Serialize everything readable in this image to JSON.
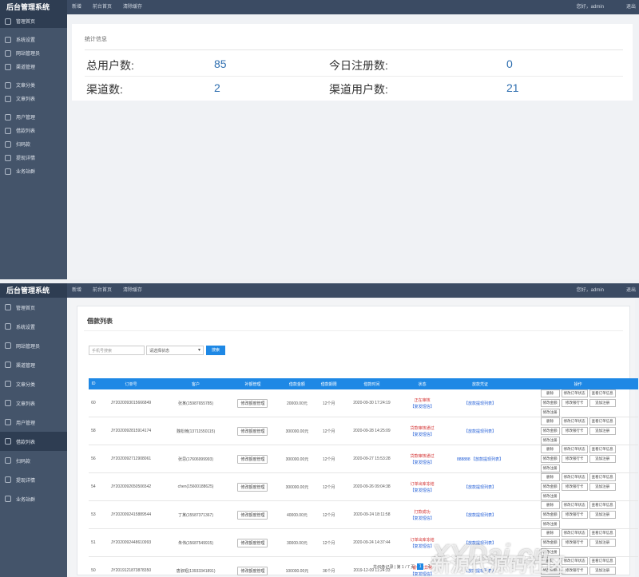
{
  "app_title": "后台管理系统",
  "top_nav": [
    "新增",
    "前台首页",
    "清除缓存"
  ],
  "user_greeting": "您好，admin",
  "logout": "退出",
  "sidebar1": [
    "管理首页",
    "系统设置",
    "网站管理员",
    "渠道管理",
    "文章分类",
    "文章列表",
    "用户管理",
    "借款列表",
    "扫码款",
    "提现详情",
    "业务站群"
  ],
  "stats": {
    "title": "统计信息",
    "total_users_label": "总用户数:",
    "total_users": "85",
    "today_reg_label": "今日注册数:",
    "today_reg": "0",
    "channels_label": "渠道数:",
    "channels": "2",
    "channel_users_label": "渠道用户数:",
    "channel_users": "21"
  },
  "sidebar2": [
    "管理首页",
    "系统设置",
    "网站管理员",
    "渠道管理",
    "文章分类",
    "文章列表",
    "用户管理",
    "借款列表",
    "扫码款",
    "提现详情",
    "业务站群"
  ],
  "loan": {
    "title": "借款列表",
    "search_placeholder": "手机号搜索",
    "select_value": "请选择状态",
    "search_button": "搜索",
    "headers": [
      "ID",
      "订单号",
      "客户",
      "补额管理",
      "借款金额",
      "借款期限",
      "借款时间",
      "状态",
      "放款凭证",
      "操作"
    ],
    "rows": [
      {
        "id": "60",
        "order": "JY2020093015666849",
        "customer": "张某(15987655785)",
        "amount": "20000.00元",
        "term": "12个月",
        "time": "2020-09-30 17:24:19",
        "status1": "正在审核",
        "status2": "【复发短信】",
        "voucher": "【放款提现列表】"
      },
      {
        "id": "58",
        "order": "JY2020092815914174",
        "customer": "魏松楠(13711550115)",
        "amount": "300000.00元",
        "term": "12个月",
        "time": "2020-09-28 14:25:09",
        "status1": "贷款审核通过",
        "status2": "【复发短信】",
        "voucher": "【放款提现列表】"
      },
      {
        "id": "56",
        "order": "JY2020092712908061",
        "customer": "张思(17606999993)",
        "amount": "300000.00元",
        "term": "12个月",
        "time": "2020-09-27 15:53:28",
        "status1": "贷款审核通过",
        "status2": "【复发短信】",
        "voucher": "888888 【放款提现列表】"
      },
      {
        "id": "54",
        "order": "JY2020092650506542",
        "customer": "chen(15600188625)",
        "amount": "300000.00元",
        "term": "12个月",
        "time": "2020-09-26 09:04:38",
        "status1": "订单出库冻结",
        "status2": "【复发短信】",
        "voucher": "【放款提现列表】"
      },
      {
        "id": "53",
        "order": "JY2020092415889544",
        "customer": "丁某(15587371367)",
        "amount": "40000.00元",
        "term": "12个月",
        "time": "2020-09-24 18:11:58",
        "status1": "打款成功",
        "status2": "【复发短信】",
        "voucher": "【放款提现列表】"
      },
      {
        "id": "51",
        "order": "JY2020092448610993",
        "customer": "朱伟(15687549915)",
        "amount": "30000.00元",
        "term": "12个月",
        "time": "2020-09-24 14:37:44",
        "status1": "订单出库冻结",
        "status2": "【复发短信】",
        "voucher": "【放款提现列表】"
      },
      {
        "id": "50",
        "order": "JY2019121873878350",
        "customer": "唐淑昭(13933341891)",
        "amount": "100000.00元",
        "term": "36个月",
        "time": "2019-12-09 11:24:33",
        "status1": "银行卡异常",
        "status2": "【复发短信】",
        "voucher": "【放款提现列表】"
      }
    ],
    "quota_button": "修改额度管理",
    "ops": [
      "删除",
      "修改订单状态",
      "查看订单信息",
      "修改金额",
      "修改银行卡",
      "追加注册",
      "修改注册"
    ],
    "pager_text": "共49条记录 | 第 1 / 7 页",
    "pages": [
      "1",
      "2"
    ]
  },
  "watermark": "XYDai.cn",
  "watermark2": "新源代源码社区"
}
